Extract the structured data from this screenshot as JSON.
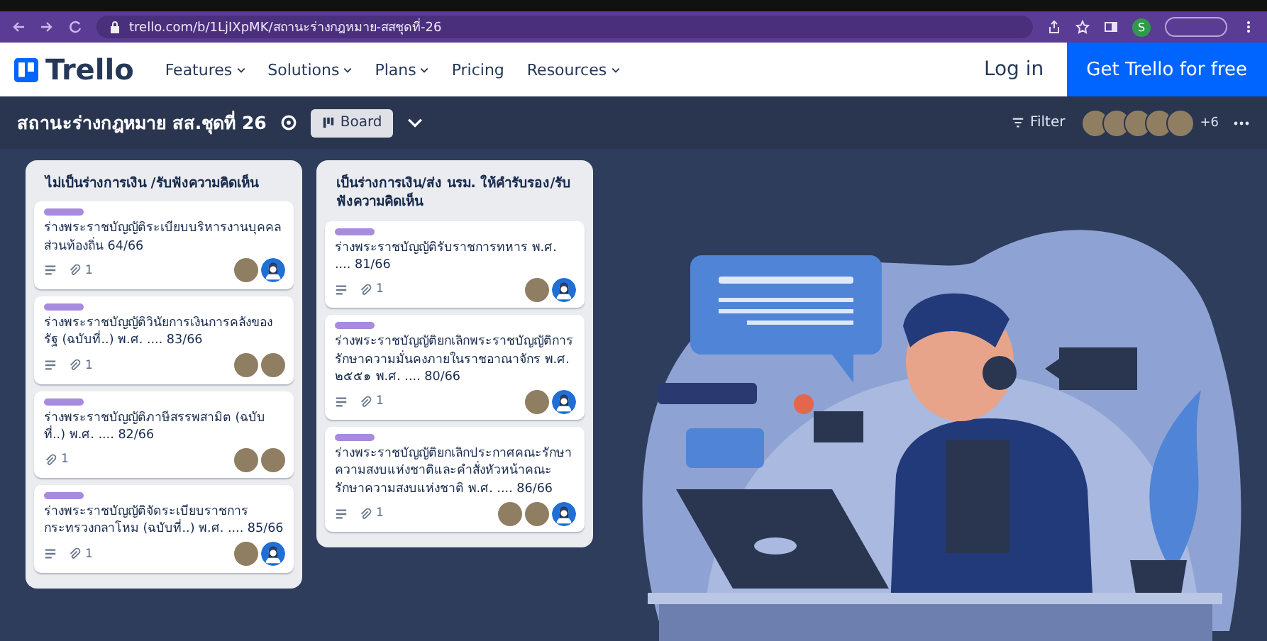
{
  "browser": {
    "url": "trello.com/b/1LjIXpMK/สถานะร่างกฎหมาย-สสชุดที่-26",
    "profile_initial": "S"
  },
  "site_header": {
    "logo": "Trello",
    "nav": [
      {
        "label": "Features",
        "has_menu": true
      },
      {
        "label": "Solutions",
        "has_menu": true
      },
      {
        "label": "Plans",
        "has_menu": true
      },
      {
        "label": "Pricing",
        "has_menu": false
      },
      {
        "label": "Resources",
        "has_menu": true
      }
    ],
    "login": "Log in",
    "cta": "Get Trello for free"
  },
  "board_header": {
    "title": "สถานะร่างกฎหมาย สส.ชุดที่ 26",
    "view": "Board",
    "filter": "Filter",
    "members": [
      {
        "kind": "photo"
      },
      {
        "kind": "photo"
      },
      {
        "kind": "photo"
      },
      {
        "kind": "photo"
      },
      {
        "kind": "photo"
      }
    ],
    "more_members": "+6"
  },
  "lists": [
    {
      "title": "ไม่เป็นร่างการเงิน /รับฟังความคิดเห็น",
      "cards": [
        {
          "title": "ร่างพระราชบัญญัติระเบียบบริหารงานบุคคลส่วนท้องถิ่น 64/66",
          "has_description": true,
          "attachments": "1",
          "members": [
            {
              "kind": "photo"
            },
            {
              "kind": "person"
            }
          ]
        },
        {
          "title": "ร่างพระราชบัญญัติวินัยการเงินการคลังของรัฐ (ฉบับที่..) พ.ศ. .... 83/66",
          "has_description": true,
          "attachments": "1",
          "members": [
            {
              "kind": "photo"
            },
            {
              "kind": "photo"
            }
          ]
        },
        {
          "title": "ร่างพระราชบัญญัติภาษีสรรพสามิต (ฉบับที่..) พ.ศ. .... 82/66",
          "has_description": false,
          "attachments": "1",
          "members": [
            {
              "kind": "photo"
            },
            {
              "kind": "photo"
            }
          ]
        },
        {
          "title": "ร่างพระราชบัญญัติจัดระเบียบราชการกระทรวงกลาโหม (ฉบับที่..) พ.ศ. .... 85/66",
          "has_description": true,
          "attachments": "1",
          "members": [
            {
              "kind": "photo"
            },
            {
              "kind": "person"
            }
          ]
        }
      ]
    },
    {
      "title": "เป็นร่างการเงิน/ส่ง นรม. ให้คำรับรอง/รับฟังความคิดเห็น",
      "cards": [
        {
          "title": "ร่างพระราชบัญญัติรับราชการทหาร พ.ศ. .... 81/66",
          "has_description": true,
          "attachments": "1",
          "members": [
            {
              "kind": "photo"
            },
            {
              "kind": "person"
            }
          ]
        },
        {
          "title": "ร่างพระราชบัญญัติยกเลิกพระราชบัญญัติการรักษาความมั่นคงภายในราชอาณาจักร พ.ศ. ๒๕๕๑ พ.ศ. .... 80/66",
          "has_description": true,
          "attachments": "1",
          "members": [
            {
              "kind": "photo"
            },
            {
              "kind": "person"
            }
          ]
        },
        {
          "title": "ร่างพระราชบัญญัติยกเลิกประกาศคณะรักษาความสงบแห่งชาติและคำสั่งหัวหน้าคณะรักษาความสงบแห่งชาติ พ.ศ. .... 86/66",
          "has_description": true,
          "attachments": "1",
          "members": [
            {
              "kind": "photo"
            },
            {
              "kind": "photo"
            },
            {
              "kind": "person"
            }
          ]
        }
      ]
    }
  ]
}
